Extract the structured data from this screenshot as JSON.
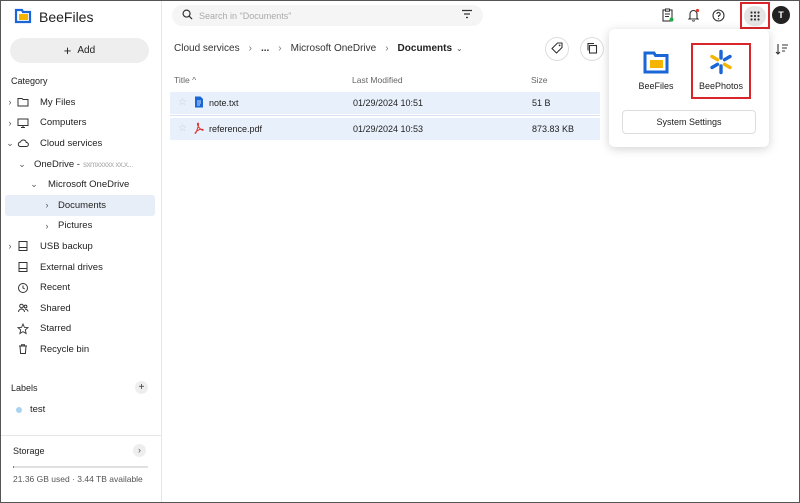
{
  "brand": {
    "name": "BeeFiles"
  },
  "sidebar": {
    "add_label": "Add",
    "category_heading": "Category",
    "items": [
      {
        "label": "My Files",
        "icon": "folder-icon",
        "chevron": "›",
        "indent": 0
      },
      {
        "label": "Computers",
        "icon": "monitor-icon",
        "chevron": "›",
        "indent": 0
      },
      {
        "label": "Cloud services",
        "icon": "cloud-icon",
        "chevron": "⌄",
        "indent": 0
      },
      {
        "label": "OneDrive -",
        "icon": "",
        "chevron": "⌄",
        "indent": 1,
        "blurred": "sxmxxxxx xx.x..."
      },
      {
        "label": "Microsoft OneDrive",
        "icon": "",
        "chevron": "⌄",
        "indent": 2
      },
      {
        "label": "Documents",
        "icon": "",
        "chevron": "›",
        "indent": 3,
        "active": true
      },
      {
        "label": "Pictures",
        "icon": "",
        "chevron": "›",
        "indent": 3
      },
      {
        "label": "USB backup",
        "icon": "usb-drive-icon",
        "chevron": "›",
        "indent": 0
      },
      {
        "label": "External drives",
        "icon": "external-drive-icon",
        "chevron": "",
        "indent": 0
      },
      {
        "label": "Recent",
        "icon": "clock-icon",
        "chevron": "",
        "indent": 0
      },
      {
        "label": "Shared",
        "icon": "people-icon",
        "chevron": "",
        "indent": 0
      },
      {
        "label": "Starred",
        "icon": "star-icon",
        "chevron": "",
        "indent": 0
      },
      {
        "label": "Recycle bin",
        "icon": "trash-icon",
        "chevron": "",
        "indent": 0
      }
    ],
    "labels_heading": "Labels",
    "tags": [
      {
        "name": "test",
        "color": "#a8d4f0"
      }
    ],
    "storage": {
      "heading": "Storage",
      "used_fraction": 0.006,
      "text": "21.36 GB used · 3.44 TB available"
    }
  },
  "topbar": {
    "search_placeholder": "Search in \"Documents\"",
    "avatar_letter": "T"
  },
  "breadcrumb": {
    "items": [
      "Cloud services",
      "...",
      "Microsoft OneDrive"
    ],
    "current": "Documents"
  },
  "table": {
    "columns": {
      "title": "Title",
      "sort_marker": "^",
      "modified": "Last Modified",
      "size": "Size"
    },
    "rows": [
      {
        "name": "note.txt",
        "type": "text-file-icon",
        "modified": "01/29/2024 10:51",
        "size": "51 B"
      },
      {
        "name": "reference.pdf",
        "type": "pdf-file-icon",
        "modified": "01/29/2024 10:53",
        "size": "873.83 KB"
      }
    ]
  },
  "app_menu": {
    "apps": [
      {
        "name": "BeeFiles"
      },
      {
        "name": "BeePhotos"
      }
    ],
    "system_settings": "System Settings"
  },
  "colors": {
    "accent_blue": "#1a66d6",
    "highlight_red": "#d9262b",
    "row_selected": "#e8f0fb",
    "brand_yellow": "#f5b400"
  }
}
